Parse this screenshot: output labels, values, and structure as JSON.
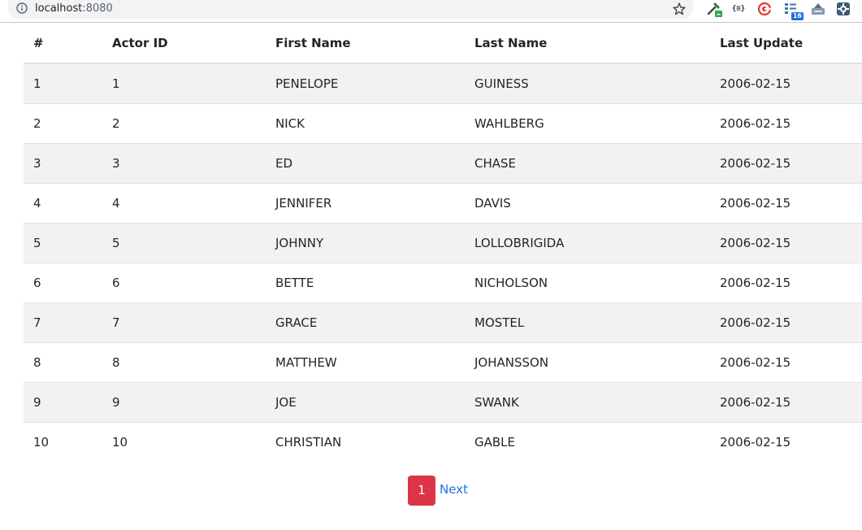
{
  "browser": {
    "host": "localhost",
    "port": ":8080",
    "extensions": [
      "eyedropper-icon",
      "json-viewer-icon",
      "target-icon",
      "tab-counter-icon",
      "inbox-icon",
      "puzzle-icon"
    ],
    "json_ext_label": "{≡}",
    "tab_count_badge": "16"
  },
  "table": {
    "headers": [
      "#",
      "Actor ID",
      "First Name",
      "Last Name",
      "Last Update"
    ],
    "rows": [
      {
        "index": "1",
        "actor_id": "1",
        "first_name": "PENELOPE",
        "last_name": "GUINESS",
        "last_update": "2006-02-15"
      },
      {
        "index": "2",
        "actor_id": "2",
        "first_name": "NICK",
        "last_name": "WAHLBERG",
        "last_update": "2006-02-15"
      },
      {
        "index": "3",
        "actor_id": "3",
        "first_name": "ED",
        "last_name": "CHASE",
        "last_update": "2006-02-15"
      },
      {
        "index": "4",
        "actor_id": "4",
        "first_name": "JENNIFER",
        "last_name": "DAVIS",
        "last_update": "2006-02-15"
      },
      {
        "index": "5",
        "actor_id": "5",
        "first_name": "JOHNNY",
        "last_name": "LOLLOBRIGIDA",
        "last_update": "2006-02-15"
      },
      {
        "index": "6",
        "actor_id": "6",
        "first_name": "BETTE",
        "last_name": "NICHOLSON",
        "last_update": "2006-02-15"
      },
      {
        "index": "7",
        "actor_id": "7",
        "first_name": "GRACE",
        "last_name": "MOSTEL",
        "last_update": "2006-02-15"
      },
      {
        "index": "8",
        "actor_id": "8",
        "first_name": "MATTHEW",
        "last_name": "JOHANSSON",
        "last_update": "2006-02-15"
      },
      {
        "index": "9",
        "actor_id": "9",
        "first_name": "JOE",
        "last_name": "SWANK",
        "last_update": "2006-02-15"
      },
      {
        "index": "10",
        "actor_id": "10",
        "first_name": "CHRISTIAN",
        "last_name": "GABLE",
        "last_update": "2006-02-15"
      }
    ]
  },
  "pagination": {
    "current_page": "1",
    "next_label": "Next"
  },
  "colors": {
    "active_page": "#dc3545",
    "link": "#1a73e8",
    "striped_row": "#f2f2f2"
  }
}
